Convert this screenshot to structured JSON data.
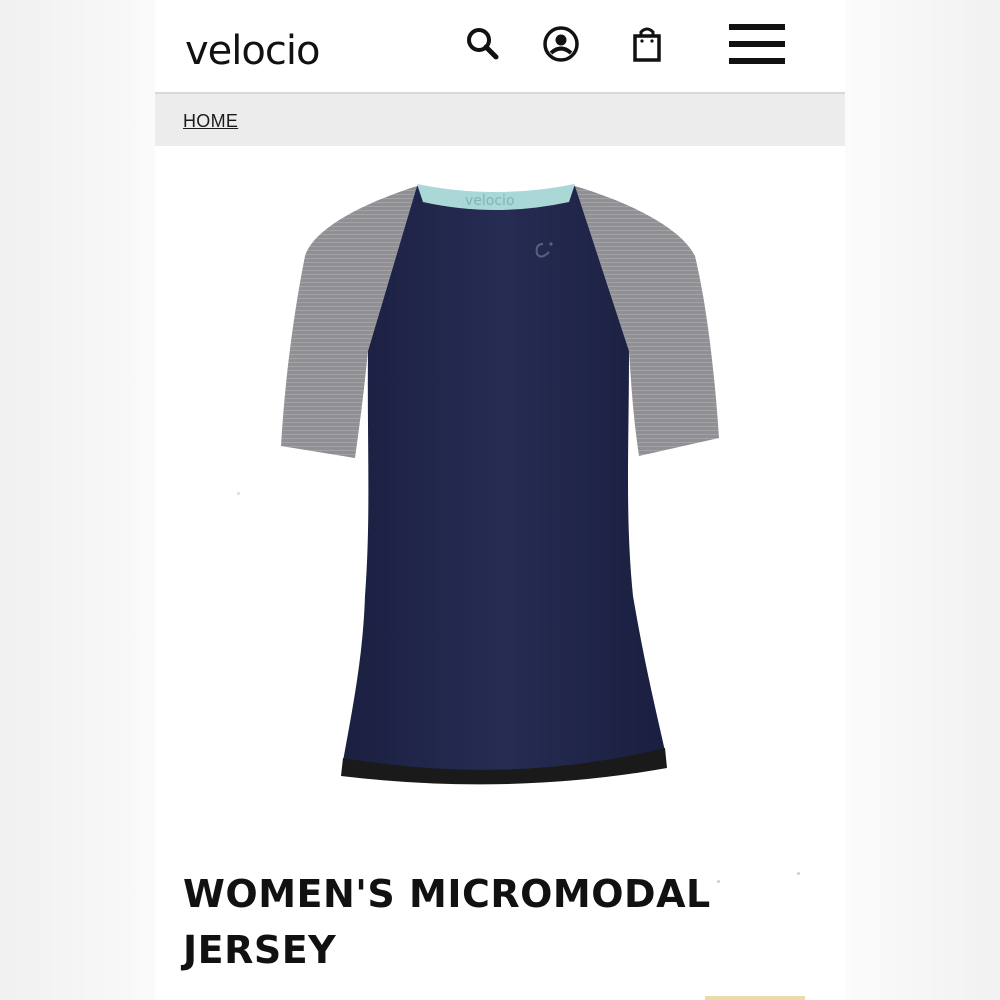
{
  "header": {
    "logo_text": "velocio",
    "icons": {
      "search": "search-icon",
      "account": "account-icon",
      "bag": "shopping-bag-icon",
      "menu": "hamburger-menu-icon"
    }
  },
  "breadcrumb": {
    "home_label": "HOME"
  },
  "product": {
    "title": "WOMEN'S MICROMODAL JERSEY",
    "collar_print": "velocio",
    "colors": {
      "body": "#1f2547",
      "sleeve": "#8e8e92",
      "collar": "#a9d8d6",
      "hem": "#1a1a1a"
    }
  }
}
